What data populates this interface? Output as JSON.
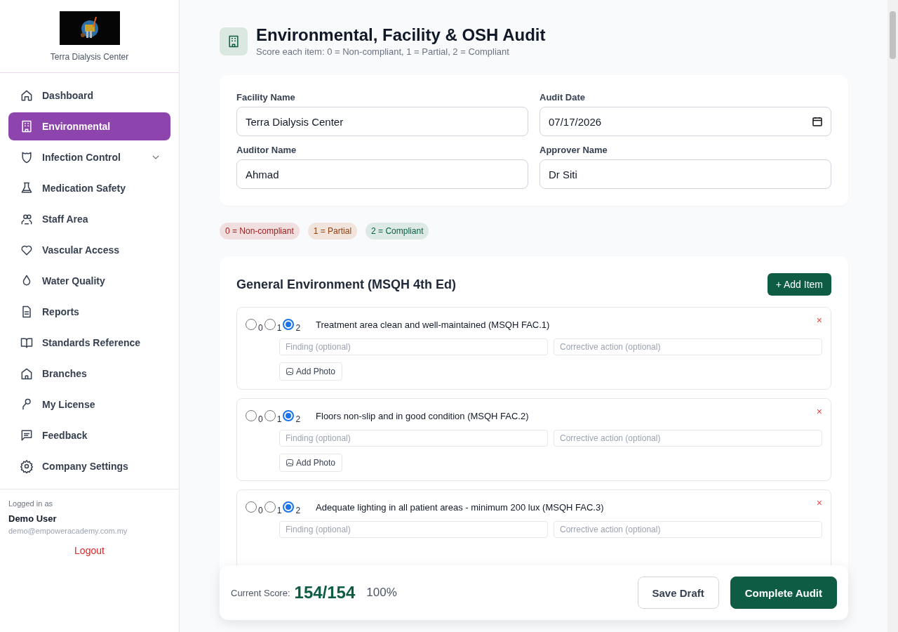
{
  "sidebar": {
    "brand": "Terra Dialysis Center",
    "items": [
      {
        "label": "Dashboard",
        "selected": false,
        "expandable": false
      },
      {
        "label": "Environmental",
        "selected": true,
        "expandable": false
      },
      {
        "label": "Infection Control",
        "selected": false,
        "expandable": true
      },
      {
        "label": "Medication Safety",
        "selected": false,
        "expandable": false
      },
      {
        "label": "Staff Area",
        "selected": false,
        "expandable": false
      },
      {
        "label": "Vascular Access",
        "selected": false,
        "expandable": false
      },
      {
        "label": "Water Quality",
        "selected": false,
        "expandable": false
      },
      {
        "label": "Reports",
        "selected": false,
        "expandable": false
      },
      {
        "label": "Standards Reference",
        "selected": false,
        "expandable": false
      },
      {
        "label": "Branches",
        "selected": false,
        "expandable": false
      },
      {
        "label": "My License",
        "selected": false,
        "expandable": false
      },
      {
        "label": "Feedback",
        "selected": false,
        "expandable": false
      },
      {
        "label": "Company Settings",
        "selected": false,
        "expandable": false
      }
    ],
    "user": {
      "caption": "Logged in as",
      "name": "Demo User",
      "email": "demo@empoweracademy.com.my",
      "logout": "Logout"
    }
  },
  "header": {
    "title": "Environmental, Facility & OSH Audit",
    "subtitle": "Score each item: 0 = Non-compliant, 1 = Partial, 2 = Compliant"
  },
  "form": {
    "fields": [
      {
        "label": "Facility Name",
        "value": "Terra Dialysis Center",
        "kind": "text"
      },
      {
        "label": "Audit Date",
        "value": "07/17/2026",
        "kind": "date"
      },
      {
        "label": "Auditor Name",
        "value": "Ahmad",
        "kind": "text"
      },
      {
        "label": "Approver Name",
        "value": "Dr Siti",
        "kind": "text"
      }
    ]
  },
  "legend": [
    {
      "label": "0 = Non-compliant",
      "color": "#991b1b"
    },
    {
      "label": "1 = Partial",
      "color": "#92400e"
    },
    {
      "label": "2 = Compliant",
      "color": "#065f46"
    }
  ],
  "section": {
    "title": "General Environment (MSQH 4th Ed)",
    "add_button": "+ Add Item",
    "items": [
      {
        "options": [
          {
            "label": "0",
            "selected": false
          },
          {
            "label": "1",
            "selected": false
          },
          {
            "label": "2",
            "selected": true
          }
        ],
        "text": "Treatment area clean and well-maintained (MSQH FAC.1)",
        "remove": "×",
        "finding_placeholder": "Finding (optional)",
        "action_placeholder": "Corrective action (optional)",
        "photo_button": "Add Photo"
      },
      {
        "options": [
          {
            "label": "0",
            "selected": false
          },
          {
            "label": "1",
            "selected": false
          },
          {
            "label": "2",
            "selected": true
          }
        ],
        "text": "Floors non-slip and in good condition (MSQH FAC.2)",
        "remove": "×",
        "finding_placeholder": "Finding (optional)",
        "action_placeholder": "Corrective action (optional)",
        "photo_button": "Add Photo"
      },
      {
        "options": [
          {
            "label": "0",
            "selected": false
          },
          {
            "label": "1",
            "selected": false
          },
          {
            "label": "2",
            "selected": true
          }
        ],
        "text": "Adequate lighting in all patient areas - minimum 200 lux (MSQH FAC.3)",
        "remove": "×",
        "finding_placeholder": "Finding (optional)",
        "action_placeholder": "Corrective action (optional)"
      }
    ]
  },
  "score_bar": {
    "caption": "Current Score:",
    "score": "154/154",
    "percent": "100%",
    "buttons": [
      {
        "label": "Save Draft",
        "kind": "secondary"
      },
      {
        "label": "Complete Audit",
        "kind": "primary"
      }
    ]
  }
}
